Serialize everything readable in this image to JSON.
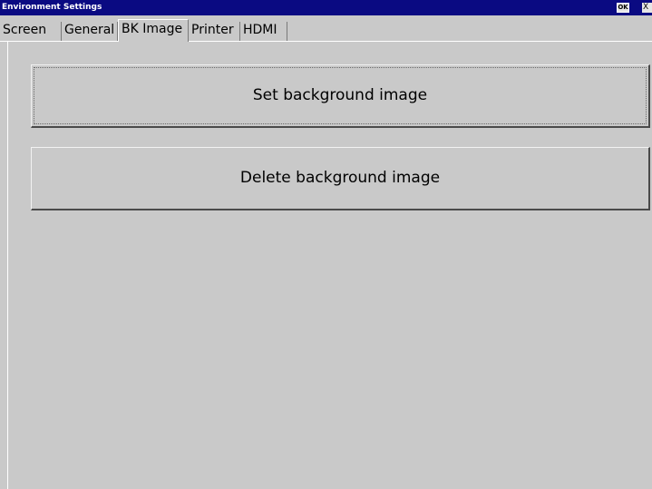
{
  "window": {
    "title": "Environment Settings",
    "ok_label": "OK",
    "close_label": "X"
  },
  "tabs": [
    {
      "label": "Screen",
      "selected": false
    },
    {
      "label": "General",
      "selected": false
    },
    {
      "label": "BK Image",
      "selected": true
    },
    {
      "label": "Printer",
      "selected": false
    },
    {
      "label": "HDMI",
      "selected": false
    }
  ],
  "buttons": {
    "set_background": "Set background image",
    "delete_background": "Delete background image"
  },
  "colors": {
    "titlebar": "#0a0a82",
    "window_background": "#c9c9c9"
  }
}
